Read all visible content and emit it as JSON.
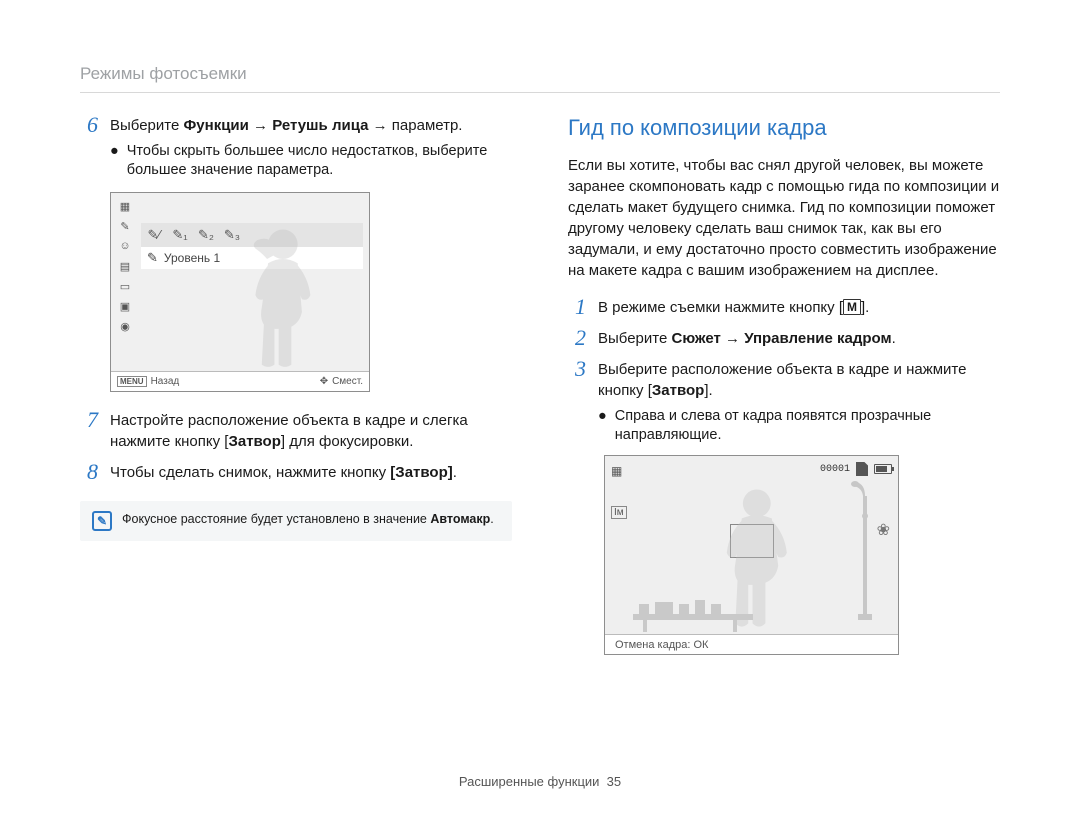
{
  "section_title": "Режимы фотосъемки",
  "left": {
    "step6": {
      "pre": "Выберите ",
      "b1": "Функции",
      "arrow": " → ",
      "b2": "Ретушь лица",
      "post": " → параметр.",
      "sub": "Чтобы скрыть большее число недостатков, выберите большее значение параметра."
    },
    "screenshot": {
      "level_label": "Уровень 1",
      "menu_back": "Назад",
      "menu_move": "Смест.",
      "menu_word": "MENU"
    },
    "step7": "Настройте расположение объекта в кадре и слегка нажмите кнопку [Затвор] для фокусировки.",
    "step7_bold": "Затвор",
    "step8_pre": "Чтобы сделать снимок, нажмите кнопку ",
    "step8_bold": "[Затвор]",
    "step8_post": ".",
    "note_pre": "Фокусное расстояние будет установлено в значение ",
    "note_bold": "Автомакр",
    "note_post": "."
  },
  "right": {
    "heading": "Гид по композиции кадра",
    "intro": "Если вы хотите, чтобы вас снял другой человек, вы можете заранее скомпоновать кадр с помощью гида по композиции и сделать макет будущего снимка. Гид по композиции поможет другому человеку сделать ваш снимок так, как вы его задумали, и ему достаточно просто совместить изображение на макете кадра с вашим изображением на дисплее.",
    "step1_pre": "В режиме съемки нажмите кнопку [",
    "step1_glyph": "M",
    "step1_post": "].",
    "step2_pre": "Выберите ",
    "step2_b1": "Сюжет",
    "step2_arrow": " → ",
    "step2_b2": "Управление кадром",
    "step2_post": ".",
    "step3_line": "Выберите расположение объекта в кадре и нажмите кнопку [Затвор].",
    "step3_bold": "Затвор",
    "step3_sub": "Справа и слева от кадра появятся прозрачные направляющие.",
    "screenshot2": {
      "counter": "00001",
      "footer": "Отмена кадра: ОК"
    }
  },
  "footer": {
    "label": "Расширенные функции",
    "page": "35"
  },
  "nums": {
    "n6": "6",
    "n7": "7",
    "n8": "8",
    "n1": "1",
    "n2": "2",
    "n3": "3"
  }
}
